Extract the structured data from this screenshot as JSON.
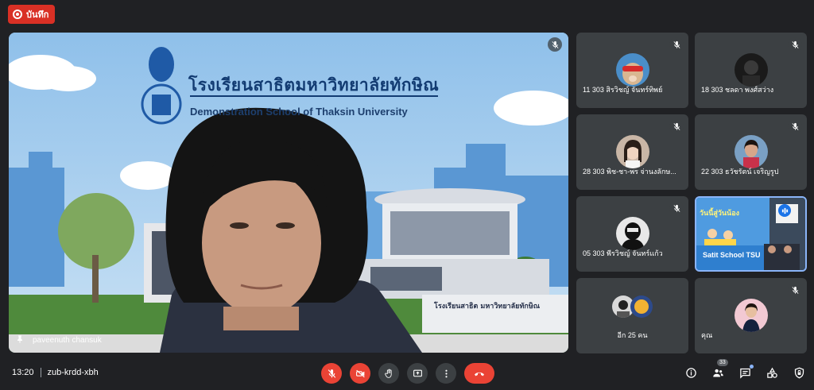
{
  "recording": {
    "label": "บันทึก"
  },
  "main": {
    "participant_name": "paveenuth chansuk",
    "background_title": "โรงเรียนสาธิตมหาวิทยาลัยทักษิณ",
    "background_subtitle": "Demonstration School of Thaksin University",
    "building_sign": "โรงเรียนสาธิต มหาวิทยาลัยทักษิณ"
  },
  "tiles": [
    {
      "name": "11 303 สิรวิชญ์ จันทร์ทิพย์",
      "avatar_color": "#4a8ec9"
    },
    {
      "name": "18 303 ชลดา พงศ์สว่าง",
      "avatar_color": "#1a1a1a"
    },
    {
      "name": "28 303 พิช-ชา-พร จ่านงลักษ...",
      "avatar_color": "#c9b6a6"
    },
    {
      "name": "22 303 ธวัชรัตน์ เจริญรูป",
      "avatar_color": "#7aa0c4"
    },
    {
      "name": "05 303 พีรวิชญ์ จันทร์แก้ว",
      "avatar_color": "#e8e8e8"
    },
    {
      "name": "Satit School TSU",
      "banner_text": "วันนี้สู่วันน้อง",
      "accent": "#8ab4f8"
    },
    {
      "name": "อีก 25 คน"
    },
    {
      "name": "คุณ",
      "avatar_color": "#f2c9d3"
    }
  ],
  "bottom": {
    "time": "13:20",
    "meeting_code": "zub-krdd-xbh",
    "participant_count": "33"
  },
  "colors": {
    "red": "#ea4335",
    "tile_bg": "#3c4043",
    "page_bg": "#202124"
  }
}
